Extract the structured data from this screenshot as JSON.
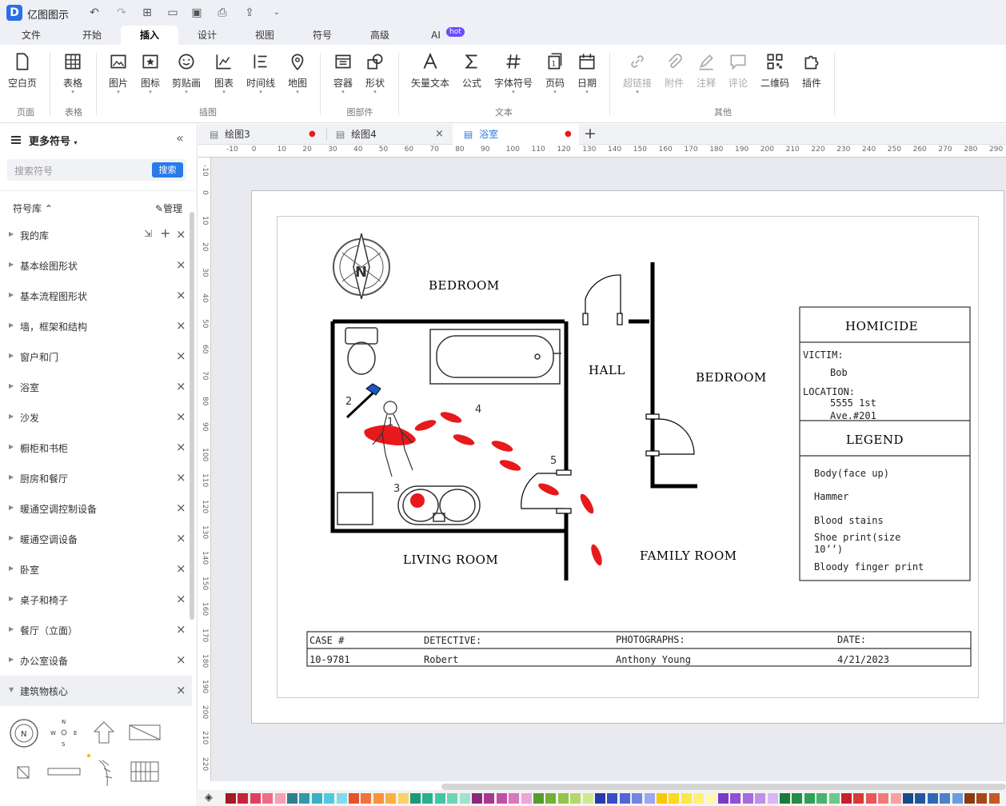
{
  "app": {
    "title": "亿图图示",
    "logo": "D"
  },
  "quick_access": [
    "undo-icon",
    "redo-icon",
    "new-icon",
    "open-icon",
    "save-icon",
    "print-icon",
    "export-icon",
    "more-icon"
  ],
  "menu_tabs": [
    "文件",
    "开始",
    "插入",
    "设计",
    "视图",
    "符号",
    "高级",
    "AI"
  ],
  "active_tab": "插入",
  "ai_badge": "hot",
  "ribbon": {
    "buttons": [
      {
        "label": "空白页",
        "icon": "page-icon"
      },
      {
        "label": "表格",
        "icon": "table-icon"
      },
      {
        "label": "图片",
        "icon": "image-icon"
      },
      {
        "label": "图标",
        "icon": "icon-icon"
      },
      {
        "label": "剪贴画",
        "icon": "clipart-icon"
      },
      {
        "label": "图表",
        "icon": "chart-icon"
      },
      {
        "label": "时间线",
        "icon": "timeline-icon"
      },
      {
        "label": "地图",
        "icon": "map-icon"
      },
      {
        "label": "容器",
        "icon": "container-icon"
      },
      {
        "label": "形状",
        "icon": "shape-icon"
      },
      {
        "label": "矢量文本",
        "icon": "vector-text-icon"
      },
      {
        "label": "公式",
        "icon": "formula-icon"
      },
      {
        "label": "字体符号",
        "icon": "symbol-icon"
      },
      {
        "label": "页码",
        "icon": "page-number-icon"
      },
      {
        "label": "日期",
        "icon": "date-icon"
      },
      {
        "label": "超链接",
        "icon": "link-icon"
      },
      {
        "label": "附件",
        "icon": "attachment-icon"
      },
      {
        "label": "注释",
        "icon": "annotation-icon"
      },
      {
        "label": "评论",
        "icon": "comment-icon"
      },
      {
        "label": "二维码",
        "icon": "qrcode-icon"
      },
      {
        "label": "插件",
        "icon": "plugin-icon"
      }
    ],
    "groups": [
      "页面",
      "表格",
      "插图",
      "图部件",
      "文本",
      "其他"
    ]
  },
  "left_panel": {
    "title": "更多符号",
    "search_placeholder": "搜索符号",
    "search_button": "搜索",
    "library_label": "符号库",
    "manage_label": "管理",
    "libraries": [
      "我的库",
      "基本绘图形状",
      "基本流程图形状",
      "墙，框架和结构",
      "窗户和门",
      "浴室",
      "沙发",
      "橱柜和书柜",
      "厨房和餐厅",
      "暖通空调控制设备",
      "暖通空调设备",
      "卧室",
      "桌子和椅子",
      "餐厅（立面）",
      "办公室设备",
      "建筑物核心"
    ]
  },
  "doc_tabs": [
    {
      "name": "绘图3",
      "state": "modified"
    },
    {
      "name": "绘图4",
      "state": "close"
    },
    {
      "name": "浴室",
      "state": "modified"
    }
  ],
  "active_doc": "浴室",
  "ruler": {
    "h_ticks": [
      "-10",
      "0",
      "10",
      "20",
      "30",
      "40",
      "50",
      "60",
      "70",
      "80",
      "90",
      "100",
      "110",
      "120",
      "130",
      "140",
      "150",
      "160",
      "170",
      "180",
      "190",
      "200",
      "210",
      "220",
      "230",
      "240",
      "250",
      "260",
      "270",
      "280",
      "290"
    ],
    "v_ticks": [
      "-10",
      "0",
      "10",
      "20",
      "30",
      "40",
      "50",
      "60",
      "70",
      "80",
      "90",
      "100",
      "110",
      "120",
      "130",
      "140",
      "150",
      "160",
      "170",
      "180",
      "190",
      "200",
      "210",
      "220"
    ]
  },
  "diagram": {
    "compass": "N",
    "rooms": [
      "BEDROOM",
      "HALL",
      "BEDROOM",
      "LIVING ROOM",
      "FAMILY ROOM"
    ],
    "markers": [
      "1",
      "2",
      "3",
      "4",
      "5"
    ],
    "homicide_title": "HOMICIDE",
    "victim_label": "VICTIM:",
    "victim_value": "Bob",
    "location_label": "LOCATION:",
    "location_line1": "5555 1st",
    "location_line2": "Ave.#201",
    "legend_title": "LEGEND",
    "legend_items": [
      "Body(face up)",
      "Hammer",
      "Blood stains",
      "Shoe print(size",
      "10’’)",
      "Bloody finger print"
    ],
    "footer": {
      "case_label": "CASE #",
      "case_value": "10-9781",
      "detective_label": "DETECTIVE:",
      "detective_value": "Robert",
      "photos_label": "PHOTOGRAPHS:",
      "photos_value": "Anthony Young",
      "date_label": "DATE:",
      "date_value": "4/21/2023"
    }
  },
  "colors": {
    "accent": "#2a7ae9",
    "blood": "#e8191b"
  },
  "palette": [
    "#a31926",
    "#c8233a",
    "#e04060",
    "#f06a8a",
    "#f8a0b4",
    "#2f7f8c",
    "#3398a8",
    "#3bb0c4",
    "#52c8de",
    "#7fdcee",
    "#e8502a",
    "#f0723a",
    "#f8923e",
    "#fbb040",
    "#fcd06a",
    "#1a9a7a",
    "#2ab08e",
    "#44c4a2",
    "#6ed4b8",
    "#9ee4cc",
    "#8a2a7a",
    "#a8388e",
    "#c44ea6",
    "#d878be",
    "#eaa8d8",
    "#5a9a2a",
    "#74b038",
    "#94c44a",
    "#b4d86a",
    "#d0e890",
    "#2a3aa8",
    "#3a4ec4",
    "#5264d8",
    "#7484e4",
    "#9aa8ee",
    "#f8c800",
    "#fcd820",
    "#fde64a",
    "#fdf07a",
    "#fef8b0",
    "#7a3ac4",
    "#9050d4",
    "#a86ae0",
    "#c090ea",
    "#d8b8f4",
    "#1a7a3a",
    "#248c46",
    "#30a056",
    "#46b46c",
    "#6ec88c",
    "#c8202a",
    "#d83a3a",
    "#e85858",
    "#f07a7a",
    "#f8a0a0",
    "#1a4a8a",
    "#2456a0",
    "#3068b8",
    "#4a82cc",
    "#6c9cdc",
    "#8a3a10",
    "#a84818",
    "#c45a24"
  ]
}
